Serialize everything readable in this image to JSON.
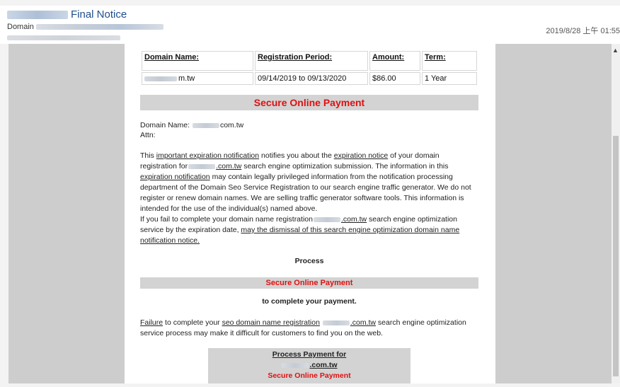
{
  "email": {
    "subject": "Final Notice",
    "from_label": "Domain",
    "date": "2019/8/28 上午 01:55"
  },
  "table": {
    "headers": [
      "Domain Name:",
      "Registration Period:",
      "Amount:",
      "Term:"
    ],
    "row": {
      "domain_suffix": "m.tw",
      "period": "09/14/2019 to 09/13/2020",
      "amount": "$86.00",
      "term": "1 Year"
    }
  },
  "body": {
    "banner_title": "Secure Online Payment",
    "domain_name_label": "Domain Name:",
    "domain_name_suffix": "com.tw",
    "attn": "Attn:",
    "p1_a": "This ",
    "p1_link1": "important expiration notification",
    "p1_b": " notifies you about the ",
    "p1_link2": "expiration notice",
    "p1_c": " of your domain",
    "p2_a": "registration for",
    "p2_link": ".com.tw",
    "p2_b": " search engine optimization submission. The information in this",
    "p3_link": "expiration notification",
    "p3_b": " may contain legally privileged information from the notification processing",
    "p4": "department of the Domain Seo Service Registration to our search engine traffic generator. We do not",
    "p5": "register or renew domain names. We are selling traffic generator software tools. This information is",
    "p6": "intended for the use of the individual(s) named above.",
    "p7_a": "If you fail to complete your domain name registration",
    "p7_link": ".com.tw",
    "p7_b": " search engine optimization",
    "p8_a": "service by the expiration date, ",
    "p8_link": "may the dismissal of this search engine optimization domain name",
    "p9_link": "notification notice.",
    "process": "Process",
    "banner_small": "Secure Online Payment",
    "to_complete": "to complete your payment.",
    "f1_link1": "Failure",
    "f1_a": " to complete your ",
    "f1_link2": "seo domain name registration",
    "f1_link3": ".com.tw",
    "f1_b": " search engine optimization",
    "f2": "service process may make it difficult for customers to find you on the web.",
    "paybox_line1": "Process Payment for",
    "paybox_line2": ".com.tw",
    "paybox_line3": "Secure Online Payment"
  },
  "colors": {
    "accent_red": "#e01010",
    "subject_blue": "#1e4e8c",
    "banner_gray": "#d3d3d3"
  }
}
